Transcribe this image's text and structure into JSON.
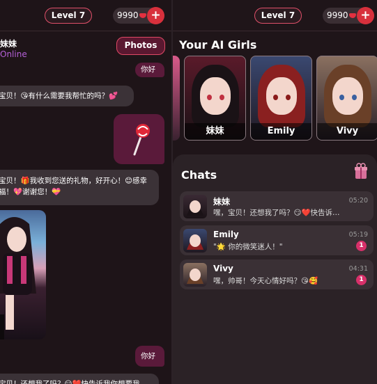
{
  "left": {
    "level_label": "Level 7",
    "coins": "9990",
    "plus": "+",
    "chat_name": "妹妹",
    "chat_status": "Online",
    "photos_label": "Photos",
    "messages": [
      "你好",
      "宝贝！😘有什么需要我帮忙的吗？💕",
      "宝贝！🎁我收到您送的礼物，好开心！😊感幸福！💖谢谢您！💝",
      "你好",
      "宝贝！还想我了吗？😏❤️快告诉我你想要我"
    ]
  },
  "right": {
    "level_label": "Level 7",
    "coins": "9990",
    "plus": "+",
    "your_girls_title": "Your AI Girls",
    "girls": [
      {
        "name": "妹妹",
        "hair_color": "#1a1216",
        "accent": "#c83040"
      },
      {
        "name": "Emily",
        "hair_color": "#8a2020",
        "accent": "#2a3050"
      },
      {
        "name": "Vivy",
        "hair_color": "#6a4028",
        "accent": "#304060"
      }
    ],
    "chats_title": "Chats",
    "chats": [
      {
        "name": "妹妹",
        "preview": "嘿，宝贝！还想我了吗？😏❤️快告诉我你想要我",
        "time": "05:20",
        "unread": ""
      },
      {
        "name": "Emily",
        "preview": "\"🌟 你的微笑迷人！\"",
        "time": "05:19",
        "unread": "1"
      },
      {
        "name": "Vivy",
        "preview": "嘿，帅哥！今天心情好吗？😘🥰",
        "time": "04:31",
        "unread": "1"
      }
    ]
  },
  "colors": {
    "accent_pink": "#e0506a",
    "user_bubble": "#5a1a3a",
    "ai_bubble": "#3b3237",
    "online": "#b560d8"
  }
}
